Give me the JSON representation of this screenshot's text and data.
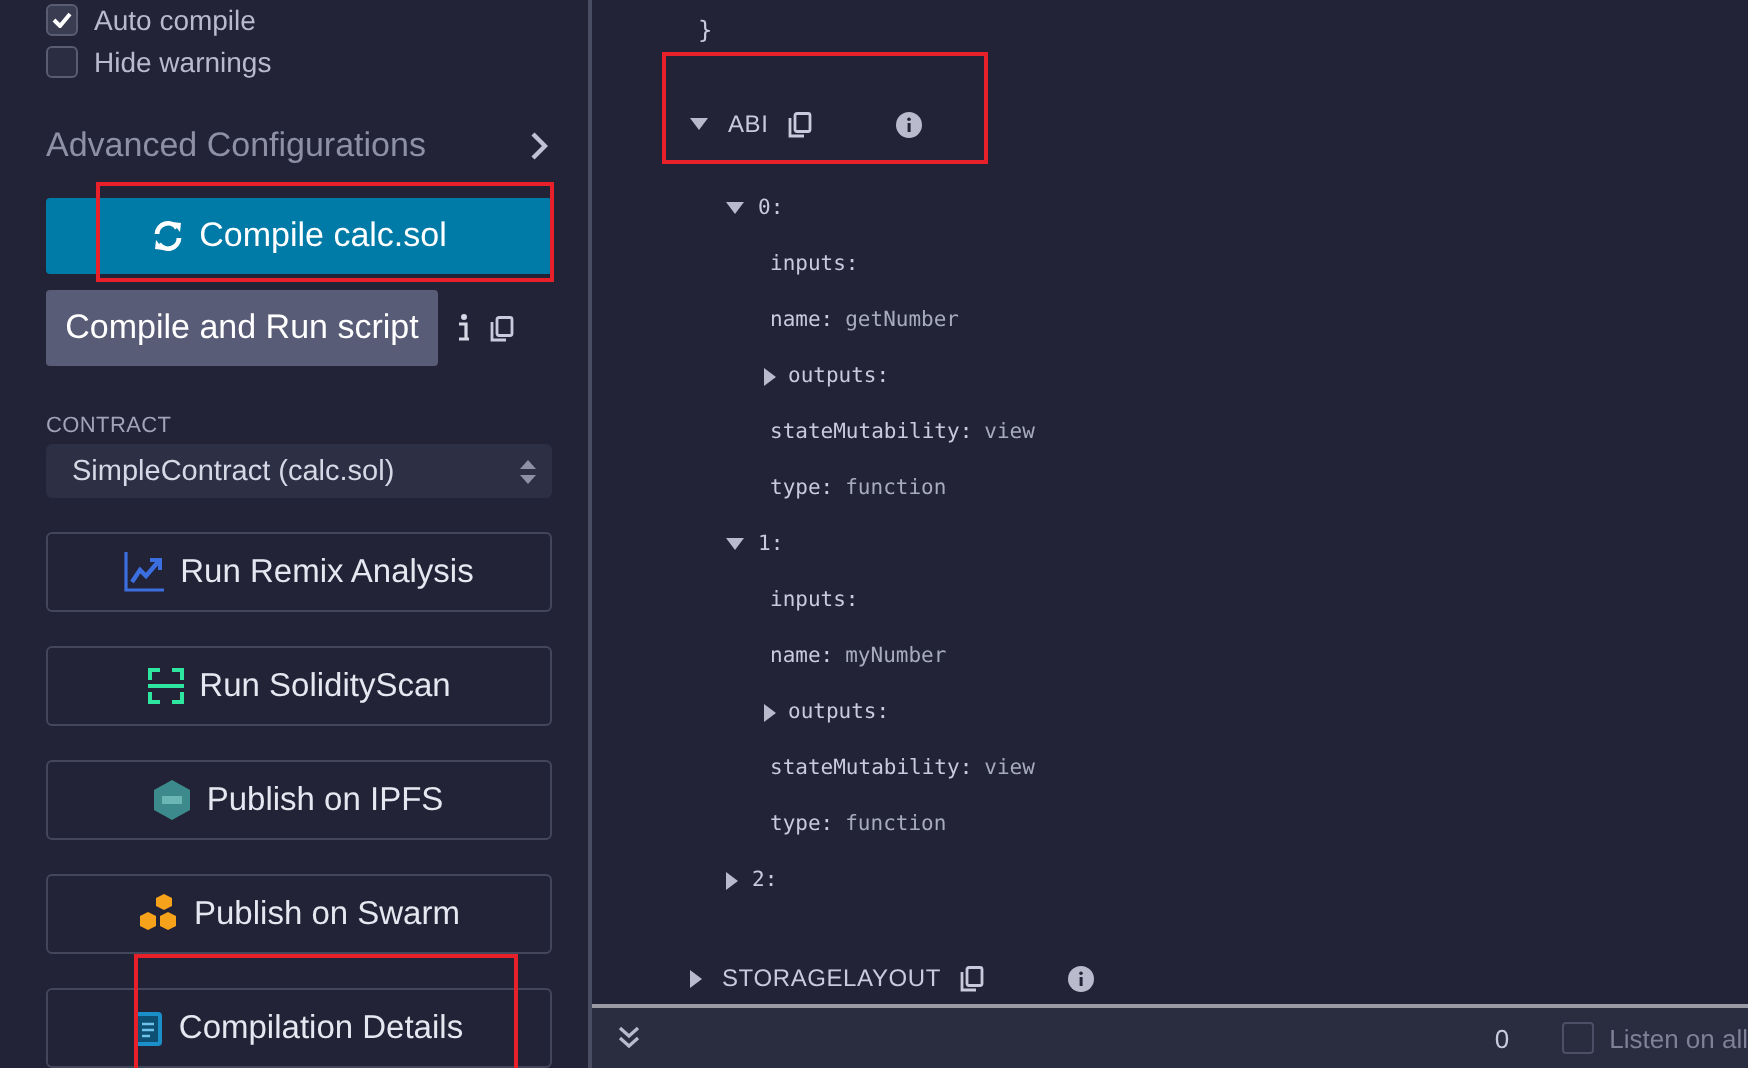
{
  "compiler_options": [
    {
      "label": "Auto compile",
      "checked": true
    },
    {
      "label": "Hide warnings",
      "checked": false
    }
  ],
  "advanced": {
    "label": "Advanced Configurations",
    "expanded": false
  },
  "compile_button": {
    "label": "Compile calc.sol",
    "highlighted": true
  },
  "run_script_button": {
    "label": "Compile and Run script"
  },
  "contract": {
    "label": "CONTRACT",
    "value": "SimpleContract (calc.sol)"
  },
  "actions": [
    {
      "label": "Run Remix Analysis",
      "kind": "analysis",
      "highlighted": false
    },
    {
      "label": "Run SolidityScan",
      "kind": "scan",
      "highlighted": false
    },
    {
      "label": "Publish on IPFS",
      "kind": "ipfs",
      "highlighted": false
    },
    {
      "label": "Publish on Swarm",
      "kind": "swarm",
      "highlighted": false
    },
    {
      "label": "Compilation Details",
      "kind": "details",
      "highlighted": true
    }
  ],
  "details": {
    "closing_brace": "}",
    "sections": [
      {
        "label": "ABI",
        "expanded": true,
        "highlighted": true,
        "children": [
          {
            "label": "0:",
            "expanded": true,
            "children": [
              {
                "key": "inputs:"
              },
              {
                "key": "name:",
                "value": "getNumber"
              },
              {
                "key": "outputs:",
                "expanded": false
              },
              {
                "key": "stateMutability:",
                "value": "view"
              },
              {
                "key": "type:",
                "value": "function"
              }
            ]
          },
          {
            "label": "1:",
            "expanded": true,
            "children": [
              {
                "key": "inputs:"
              },
              {
                "key": "name:",
                "value": "myNumber"
              },
              {
                "key": "outputs:",
                "expanded": false
              },
              {
                "key": "stateMutability:",
                "value": "view"
              },
              {
                "key": "type:",
                "value": "function"
              }
            ]
          },
          {
            "label": "2:",
            "expanded": false
          }
        ]
      },
      {
        "label": "STORAGELAYOUT",
        "expanded": false,
        "highlighted": false
      }
    ]
  },
  "terminal": {
    "count": "0",
    "listen": {
      "label": "Listen on all",
      "checked": false
    }
  }
}
